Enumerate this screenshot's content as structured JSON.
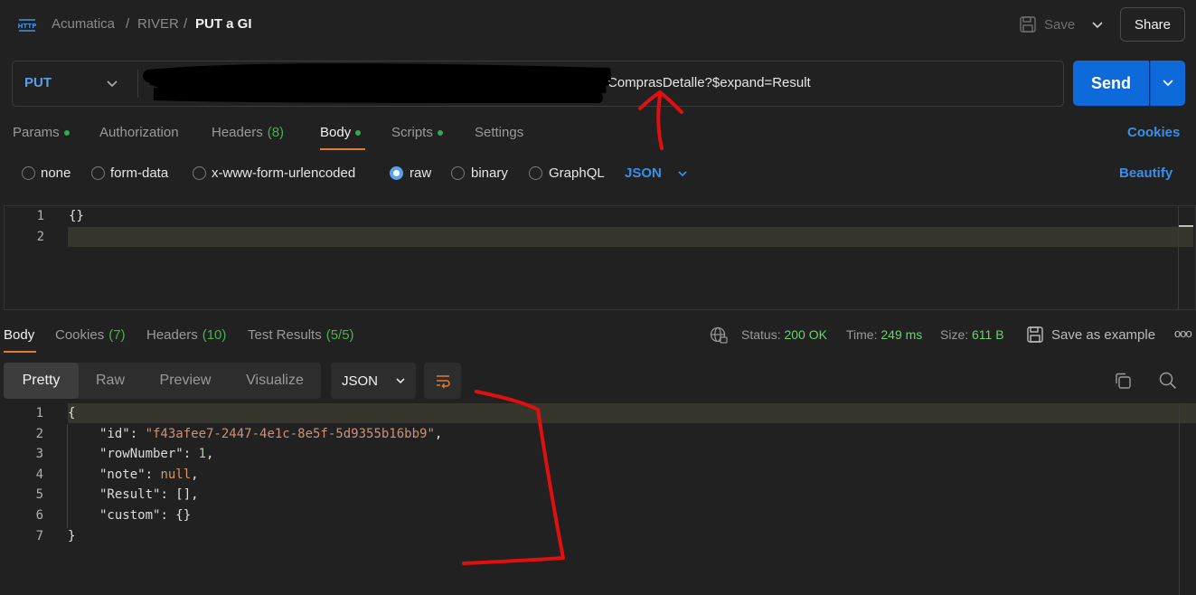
{
  "header": {
    "breadcrumb": [
      "Acumatica",
      "RIVER",
      "PUT a GI"
    ],
    "separator": "/",
    "save_label": "Save",
    "share_label": "Share",
    "http_icon": "http-icon"
  },
  "request": {
    "method": "PUT",
    "url_visible": "ComprasDetalle?$expand=Result",
    "send_label": "Send"
  },
  "request_tabs": {
    "items": [
      {
        "label": "Params",
        "dot": true
      },
      {
        "label": "Authorization"
      },
      {
        "label": "Headers",
        "count": "(8)"
      },
      {
        "label": "Body",
        "dot": true,
        "active": true
      },
      {
        "label": "Scripts",
        "dot": true
      },
      {
        "label": "Settings"
      }
    ],
    "cookies_label": "Cookies"
  },
  "body_types": {
    "options": [
      "none",
      "form-data",
      "x-www-form-urlencoded",
      "raw",
      "binary",
      "GraphQL"
    ],
    "selected": "raw",
    "format": "JSON",
    "beautify_label": "Beautify"
  },
  "request_body": {
    "lines": [
      "{}",
      ""
    ]
  },
  "response_tabs": {
    "body": "Body",
    "cookies": "Cookies",
    "cookies_count": "(7)",
    "headers": "Headers",
    "headers_count": "(10)",
    "tests": "Test Results",
    "tests_count": "(5/5)"
  },
  "response_meta": {
    "status_label": "Status:",
    "status_value": "200 OK",
    "time_label": "Time:",
    "time_value": "249 ms",
    "size_label": "Size:",
    "size_value": "611 B",
    "save_example_label": "Save as example",
    "more_label": "ooo"
  },
  "response_view": {
    "modes": [
      "Pretty",
      "Raw",
      "Preview",
      "Visualize"
    ],
    "active": "Pretty",
    "format": "JSON"
  },
  "response_body": {
    "line_numbers": [
      "1",
      "2",
      "3",
      "4",
      "5",
      "6",
      "7"
    ],
    "open": "{",
    "close": "}",
    "fields": [
      {
        "key": "\"id\"",
        "value": "\"f43afee7-2447-4e1c-8e5f-5d9355b16bb9\"",
        "kind": "str",
        "comma": true
      },
      {
        "key": "\"rowNumber\"",
        "value": "1",
        "kind": "num",
        "comma": true
      },
      {
        "key": "\"note\"",
        "value": "null",
        "kind": "kw",
        "comma": true
      },
      {
        "key": "\"Result\"",
        "value": "[]",
        "kind": "plain",
        "comma": true
      },
      {
        "key": "\"custom\"",
        "value": "{}",
        "kind": "plain",
        "comma": false
      }
    ]
  },
  "colors": {
    "accent_blue": "#0f6ad9",
    "link_blue": "#3b8fe8",
    "status_green": "#6fcf73",
    "tab_underline": "#e07b39",
    "annotation_red": "#e01010"
  }
}
